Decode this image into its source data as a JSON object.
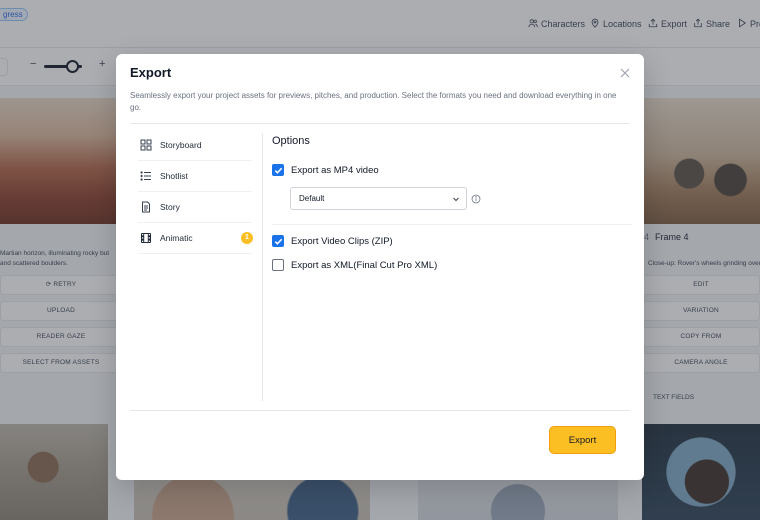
{
  "background": {
    "badge": "gress",
    "nav": [
      "Characters",
      "Locations",
      "Export",
      "Share",
      "Pre"
    ],
    "zoom_minus": "−",
    "zoom_plus": "+",
    "left_card": {
      "description": "Martian horizon, illuminating rocky but and scattered boulders.",
      "buttons": [
        "RETRY",
        "UPLOAD",
        "READER GAZE",
        "SELECT FROM ASSETS"
      ]
    },
    "right_card": {
      "frame_num": "4",
      "frame_label": "Frame 4",
      "description": "Close-up: Rover's wheels grinding over Mar",
      "buttons": [
        "EDIT",
        "VARIATION",
        "COPY FROM",
        "CAMERA ANGLE"
      ],
      "text_fields": "TEXT FIELDS"
    }
  },
  "modal": {
    "title": "Export",
    "description": "Seamlessly export your project assets for previews, pitches, and production. Select the formats you need and download everything in one go.",
    "nav": [
      {
        "label": "Storyboard",
        "icon": "grid-icon"
      },
      {
        "label": "Shotlist",
        "icon": "list-icon"
      },
      {
        "label": "Story",
        "icon": "document-icon"
      },
      {
        "label": "Animatic",
        "icon": "film-icon",
        "badge": "1"
      }
    ],
    "options_title": "Options",
    "options": {
      "mp4": {
        "label": "Export as MP4 video",
        "checked": true
      },
      "quality": {
        "value": "Default"
      },
      "clips": {
        "label": "Export Video Clips (ZIP)",
        "checked": true
      },
      "xml": {
        "label": "Export as XML(Final Cut Pro XML)",
        "checked": false
      }
    },
    "export_button": "Export"
  },
  "colors": {
    "accent": "#fbbf24",
    "checkbox": "#1a73e8",
    "overlay": "#373c44"
  }
}
